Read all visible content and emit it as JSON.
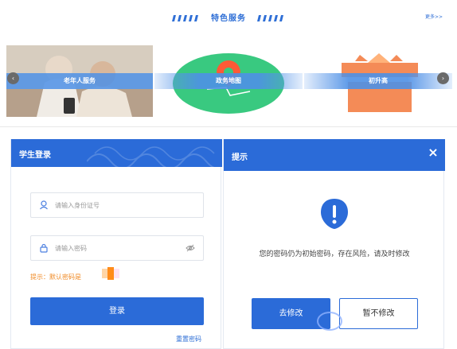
{
  "services": {
    "title": "特色服务",
    "more": "更多>>",
    "cards": [
      {
        "label": "老年人服务"
      },
      {
        "label": "政务地图"
      },
      {
        "label": "初升高"
      }
    ],
    "prev_icon": "chevron-left-icon",
    "next_icon": "chevron-right-icon"
  },
  "login": {
    "title": "学生登录",
    "id_placeholder": "请输入身份证号",
    "password_placeholder": "请输入密码",
    "hint": "提示：默认密码是",
    "button": "登录",
    "reset": "重置密码"
  },
  "dialog": {
    "title": "提示",
    "close": "×",
    "message": "您的密码仍为初始密码，存在风险，请及时修改",
    "confirm": "去修改",
    "later": "暂不修改"
  },
  "colors": {
    "primary": "#2b6bd8",
    "warning": "#f08a24",
    "map_green": "#39c980",
    "gift_orange": "#f48b57"
  }
}
